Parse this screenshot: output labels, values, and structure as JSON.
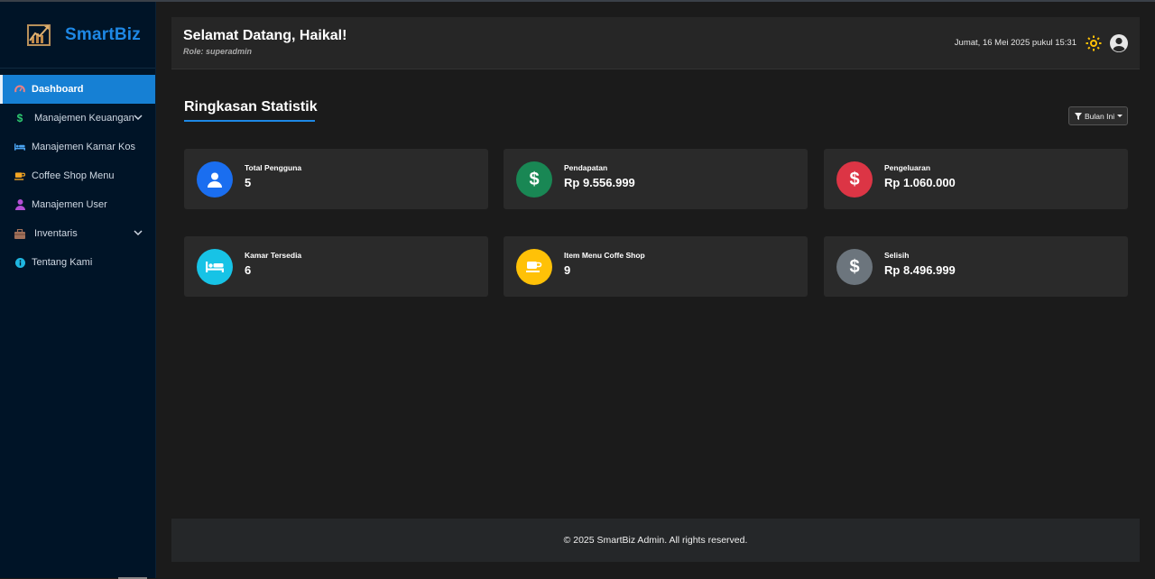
{
  "app": {
    "brand": "SmartBiz",
    "brand_color": "#1e88e5"
  },
  "sidebar": {
    "items": [
      {
        "label": "Dashboard",
        "icon": "gauge-icon",
        "active": true
      },
      {
        "label": "Manajemen Keuangan",
        "icon": "dollar-icon",
        "expandable": true
      },
      {
        "label": "Manajemen Kamar Kos",
        "icon": "bed-icon"
      },
      {
        "label": "Coffee Shop Menu",
        "icon": "coffee-icon"
      },
      {
        "label": "Manajemen User",
        "icon": "user-icon"
      },
      {
        "label": "Inventaris",
        "icon": "box-icon",
        "expandable": true
      },
      {
        "label": "Tentang Kami",
        "icon": "info-icon"
      }
    ]
  },
  "header": {
    "welcome": "Selamat Datang, Haikal!",
    "role": "Role: superadmin",
    "datetime": "Jumat, 16 Mei 2025 pukul 15:31",
    "theme_icon": "sun-icon",
    "profile_icon": "user-circle-icon"
  },
  "main": {
    "section_title": "Ringkasan Statistik",
    "filter_label": "Bulan Ini",
    "cards": [
      {
        "label": "Total Pengguna",
        "value": "5",
        "icon": "user-icon",
        "color": "#1a6ef0"
      },
      {
        "label": "Pendapatan",
        "value": "Rp 9.556.999",
        "icon": "dollar-icon",
        "color": "#198754"
      },
      {
        "label": "Pengeluaran",
        "value": "Rp 1.060.000",
        "icon": "dollar-icon",
        "color": "#dc3545"
      },
      {
        "label": "Kamar Tersedia",
        "value": "6",
        "icon": "bed-icon",
        "color": "#17c3e6"
      },
      {
        "label": "Item Menu Coffe Shop",
        "value": "9",
        "icon": "coffee-icon",
        "color": "#ffc107"
      },
      {
        "label": "Selisih",
        "value": "Rp 8.496.999",
        "icon": "dollar-icon",
        "color": "#6c757d"
      }
    ]
  },
  "footer": {
    "text": "© 2025 SmartBiz Admin. All rights reserved."
  }
}
